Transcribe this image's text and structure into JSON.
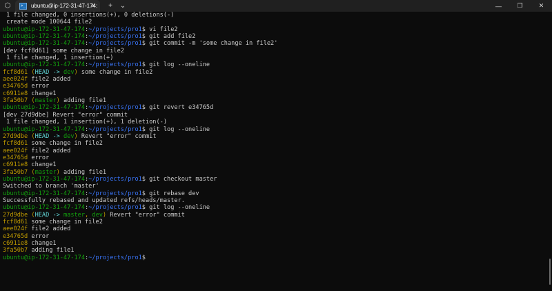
{
  "window": {
    "tab_title": "ubuntu@ip-172-31-47-174:",
    "tab_close": "✕",
    "new_tab": "+",
    "dropdown": "⌄",
    "minimize": "—",
    "maximize": "❐",
    "close": "✕",
    "shield": "⬡",
    "tab_icon": ">_"
  },
  "terminal": {
    "lines": [
      [
        [
          " 1 file changed, 0 insertions(+), 0 deletions(-)",
          "w"
        ]
      ],
      [
        [
          " create mode 100644 file2",
          "w"
        ]
      ],
      [
        [
          "ubuntu@ip-172-31-47-174",
          "u"
        ],
        [
          ":",
          "w"
        ],
        [
          "~/projects/pro1",
          "p"
        ],
        [
          "$ vi file2",
          "w"
        ]
      ],
      [
        [
          "ubuntu@ip-172-31-47-174",
          "u"
        ],
        [
          ":",
          "w"
        ],
        [
          "~/projects/pro1",
          "p"
        ],
        [
          "$ git add file2",
          "w"
        ]
      ],
      [
        [
          "ubuntu@ip-172-31-47-174",
          "u"
        ],
        [
          ":",
          "w"
        ],
        [
          "~/projects/pro1",
          "p"
        ],
        [
          "$ git commit -m 'some change in file2'",
          "w"
        ]
      ],
      [
        [
          "[dev fcf8d61] some change in file2",
          "w"
        ]
      ],
      [
        [
          " 1 file changed, 1 insertion(+)",
          "w"
        ]
      ],
      [
        [
          "ubuntu@ip-172-31-47-174",
          "u"
        ],
        [
          ":",
          "w"
        ],
        [
          "~/projects/pro1",
          "p"
        ],
        [
          "$ git log --oneline",
          "w"
        ]
      ],
      [
        [
          "fcf8d61",
          "h"
        ],
        [
          " (",
          "h"
        ],
        [
          "HEAD -> ",
          "c"
        ],
        [
          "dev",
          "u"
        ],
        [
          ")",
          "h"
        ],
        [
          " some change in file2",
          "w"
        ]
      ],
      [
        [
          "aee024f",
          "h"
        ],
        [
          " file2 added",
          "w"
        ]
      ],
      [
        [
          "e34765d",
          "h"
        ],
        [
          " error",
          "w"
        ]
      ],
      [
        [
          "c6911e8",
          "h"
        ],
        [
          " change1",
          "w"
        ]
      ],
      [
        [
          "3fa50b7",
          "h"
        ],
        [
          " (",
          "h"
        ],
        [
          "master",
          "u"
        ],
        [
          ")",
          "h"
        ],
        [
          " adding file1",
          "w"
        ]
      ],
      [
        [
          "ubuntu@ip-172-31-47-174",
          "u"
        ],
        [
          ":",
          "w"
        ],
        [
          "~/projects/pro1",
          "p"
        ],
        [
          "$ git revert e34765d",
          "w"
        ]
      ],
      [
        [
          "[dev 27d9dbe] Revert \"error\" commit",
          "w"
        ]
      ],
      [
        [
          " 1 file changed, 1 insertion(+), 1 deletion(-)",
          "w"
        ]
      ],
      [
        [
          "ubuntu@ip-172-31-47-174",
          "u"
        ],
        [
          ":",
          "w"
        ],
        [
          "~/projects/pro1",
          "p"
        ],
        [
          "$ git log --oneline",
          "w"
        ]
      ],
      [
        [
          "27d9dbe",
          "h"
        ],
        [
          " (",
          "h"
        ],
        [
          "HEAD -> ",
          "c"
        ],
        [
          "dev",
          "u"
        ],
        [
          ")",
          "h"
        ],
        [
          " Revert \"error\" commit",
          "w"
        ]
      ],
      [
        [
          "fcf8d61",
          "h"
        ],
        [
          " some change in file2",
          "w"
        ]
      ],
      [
        [
          "aee024f",
          "h"
        ],
        [
          " file2 added",
          "w"
        ]
      ],
      [
        [
          "e34765d",
          "h"
        ],
        [
          " error",
          "w"
        ]
      ],
      [
        [
          "c6911e8",
          "h"
        ],
        [
          " change1",
          "w"
        ]
      ],
      [
        [
          "3fa50b7",
          "h"
        ],
        [
          " (",
          "h"
        ],
        [
          "master",
          "u"
        ],
        [
          ")",
          "h"
        ],
        [
          " adding file1",
          "w"
        ]
      ],
      [
        [
          "ubuntu@ip-172-31-47-174",
          "u"
        ],
        [
          ":",
          "w"
        ],
        [
          "~/projects/pro1",
          "p"
        ],
        [
          "$ git checkout master",
          "w"
        ]
      ],
      [
        [
          "Switched to branch 'master'",
          "w"
        ]
      ],
      [
        [
          "ubuntu@ip-172-31-47-174",
          "u"
        ],
        [
          ":",
          "w"
        ],
        [
          "~/projects/pro1",
          "p"
        ],
        [
          "$ git rebase dev",
          "w"
        ]
      ],
      [
        [
          "Successfully rebased and updated refs/heads/master.",
          "w"
        ]
      ],
      [
        [
          "ubuntu@ip-172-31-47-174",
          "u"
        ],
        [
          ":",
          "w"
        ],
        [
          "~/projects/pro1",
          "p"
        ],
        [
          "$ git log --oneline",
          "w"
        ]
      ],
      [
        [
          "27d9dbe",
          "h"
        ],
        [
          " (",
          "h"
        ],
        [
          "HEAD -> ",
          "c"
        ],
        [
          "master",
          "u"
        ],
        [
          ", ",
          "h"
        ],
        [
          "dev",
          "u"
        ],
        [
          ")",
          "h"
        ],
        [
          " Revert \"error\" commit",
          "w"
        ]
      ],
      [
        [
          "fcf8d61",
          "h"
        ],
        [
          " some change in file2",
          "w"
        ]
      ],
      [
        [
          "aee024f",
          "h"
        ],
        [
          " file2 added",
          "w"
        ]
      ],
      [
        [
          "e34765d",
          "h"
        ],
        [
          " error",
          "w"
        ]
      ],
      [
        [
          "c6911e8",
          "h"
        ],
        [
          " change1",
          "w"
        ]
      ],
      [
        [
          "3fa50b7",
          "h"
        ],
        [
          " adding file1",
          "w"
        ]
      ],
      [
        [
          "ubuntu@ip-172-31-47-174",
          "u"
        ],
        [
          ":",
          "w"
        ],
        [
          "~/projects/pro1",
          "p"
        ],
        [
          "$ ",
          "w"
        ]
      ]
    ]
  }
}
